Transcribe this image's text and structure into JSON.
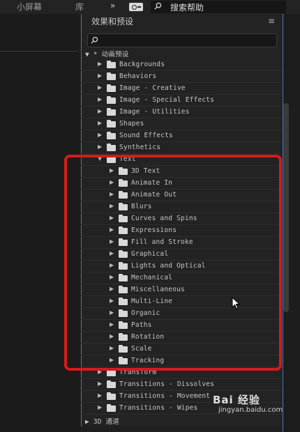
{
  "topbar": {
    "tab_small_screen": "小屏幕",
    "tab_library": "库",
    "more_icon": "»",
    "workspace_icon": "workspace-icon",
    "help_search_text": "搜索帮助"
  },
  "panel": {
    "title": "效果和预设",
    "menu_icon": "≡",
    "search_placeholder": ""
  },
  "tree": [
    {
      "label": "▼ * 动画预设",
      "level": 0,
      "expanded": true,
      "folder": false
    },
    {
      "label": "Backgrounds",
      "level": 1,
      "expanded": false,
      "folder": true
    },
    {
      "label": "Behaviors",
      "level": 1,
      "expanded": false,
      "folder": true
    },
    {
      "label": "Image - Creative",
      "level": 1,
      "expanded": false,
      "folder": true
    },
    {
      "label": "Image - Special Effects",
      "level": 1,
      "expanded": false,
      "folder": true
    },
    {
      "label": "Image - Utilities",
      "level": 1,
      "expanded": false,
      "folder": true
    },
    {
      "label": "Shapes",
      "level": 1,
      "expanded": false,
      "folder": true
    },
    {
      "label": "Sound Effects",
      "level": 1,
      "expanded": false,
      "folder": true
    },
    {
      "label": "Synthetics",
      "level": 1,
      "expanded": false,
      "folder": true
    },
    {
      "label": "Text",
      "level": 1,
      "expanded": true,
      "folder": true
    },
    {
      "label": "3D Text",
      "level": 2,
      "expanded": false,
      "folder": true
    },
    {
      "label": "Animate In",
      "level": 2,
      "expanded": false,
      "folder": true
    },
    {
      "label": "Animate Out",
      "level": 2,
      "expanded": false,
      "folder": true
    },
    {
      "label": "Blurs",
      "level": 2,
      "expanded": false,
      "folder": true
    },
    {
      "label": "Curves and Spins",
      "level": 2,
      "expanded": false,
      "folder": true
    },
    {
      "label": "Expressions",
      "level": 2,
      "expanded": false,
      "folder": true
    },
    {
      "label": "Fill and Stroke",
      "level": 2,
      "expanded": false,
      "folder": true
    },
    {
      "label": "Graphical",
      "level": 2,
      "expanded": false,
      "folder": true
    },
    {
      "label": "Lights and Optical",
      "level": 2,
      "expanded": false,
      "folder": true
    },
    {
      "label": "Mechanical",
      "level": 2,
      "expanded": false,
      "folder": true
    },
    {
      "label": "Miscellaneous",
      "level": 2,
      "expanded": false,
      "folder": true
    },
    {
      "label": "Multi-Line",
      "level": 2,
      "expanded": false,
      "folder": true
    },
    {
      "label": "Organic",
      "level": 2,
      "expanded": false,
      "folder": true
    },
    {
      "label": "Paths",
      "level": 2,
      "expanded": false,
      "folder": true
    },
    {
      "label": "Rotation",
      "level": 2,
      "expanded": false,
      "folder": true
    },
    {
      "label": "Scale",
      "level": 2,
      "expanded": false,
      "folder": true
    },
    {
      "label": "Tracking",
      "level": 2,
      "expanded": false,
      "folder": true
    },
    {
      "label": "Transform",
      "level": 1,
      "expanded": false,
      "folder": true
    },
    {
      "label": "Transitions - Dissolves",
      "level": 1,
      "expanded": false,
      "folder": true
    },
    {
      "label": "Transitions - Movement",
      "level": 1,
      "expanded": false,
      "folder": true
    },
    {
      "label": "Transitions - Wipes",
      "level": 1,
      "expanded": false,
      "folder": true
    },
    {
      "label": "▶ 3D 通道",
      "level": 0,
      "expanded": false,
      "folder": false
    }
  ],
  "watermark": {
    "logo": "Bai 经验",
    "url": "jingyan.baidu.com"
  },
  "colors": {
    "highlight_border": "#d81a1a",
    "panel_border": "#4a77b0"
  }
}
